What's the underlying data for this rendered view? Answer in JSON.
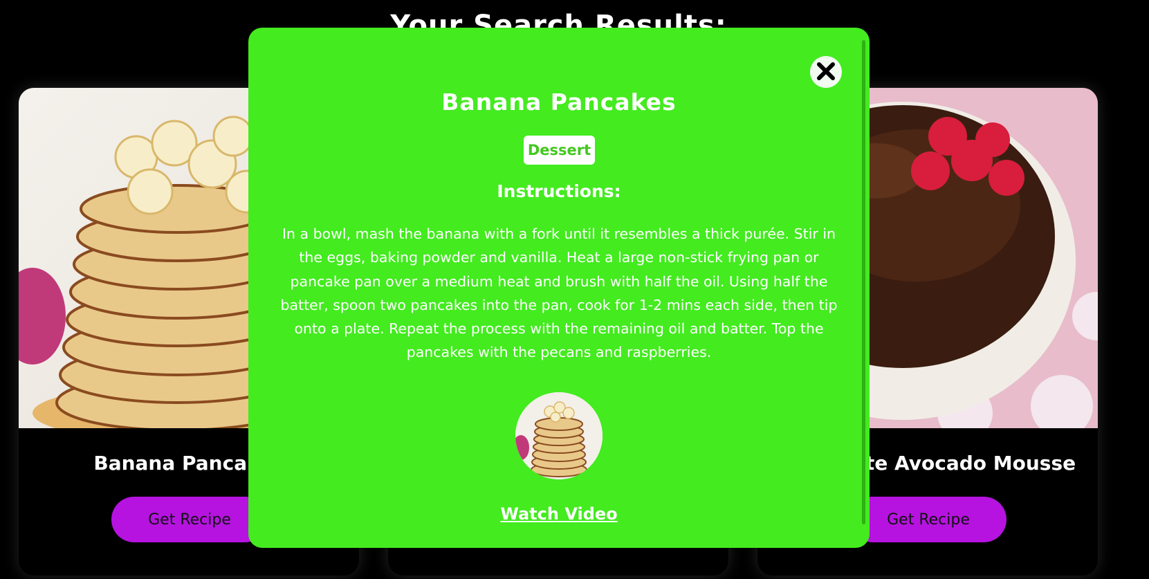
{
  "page": {
    "heading": "Your Search Results:"
  },
  "cards": [
    {
      "title": "Banana Pancakes",
      "button": "Get Recipe"
    },
    {
      "title": "",
      "button": ""
    },
    {
      "title": "Chocolate Avocado Mousse",
      "button": "Get Recipe"
    }
  ],
  "modal": {
    "title": "Banana Pancakes",
    "category": "Dessert",
    "instructions_heading": "Instructions:",
    "instructions": "In a bowl, mash the banana with a fork until it resembles a thick purée. Stir in the eggs, baking powder and vanilla. Heat a large non-stick frying pan or pancake pan over a medium heat and brush with half the oil. Using half the batter, spoon two pancakes into the pan, cook for 1-2 mins each side, then tip onto a plate. Repeat the process with the remaining oil and batter. Top the pancakes with the pecans and raspberries.",
    "video_link": "Watch Video",
    "close_icon": "close-icon"
  },
  "colors": {
    "modal_background": "#43eb1f",
    "button_purple": "#b613e0",
    "page_background": "#000000"
  }
}
